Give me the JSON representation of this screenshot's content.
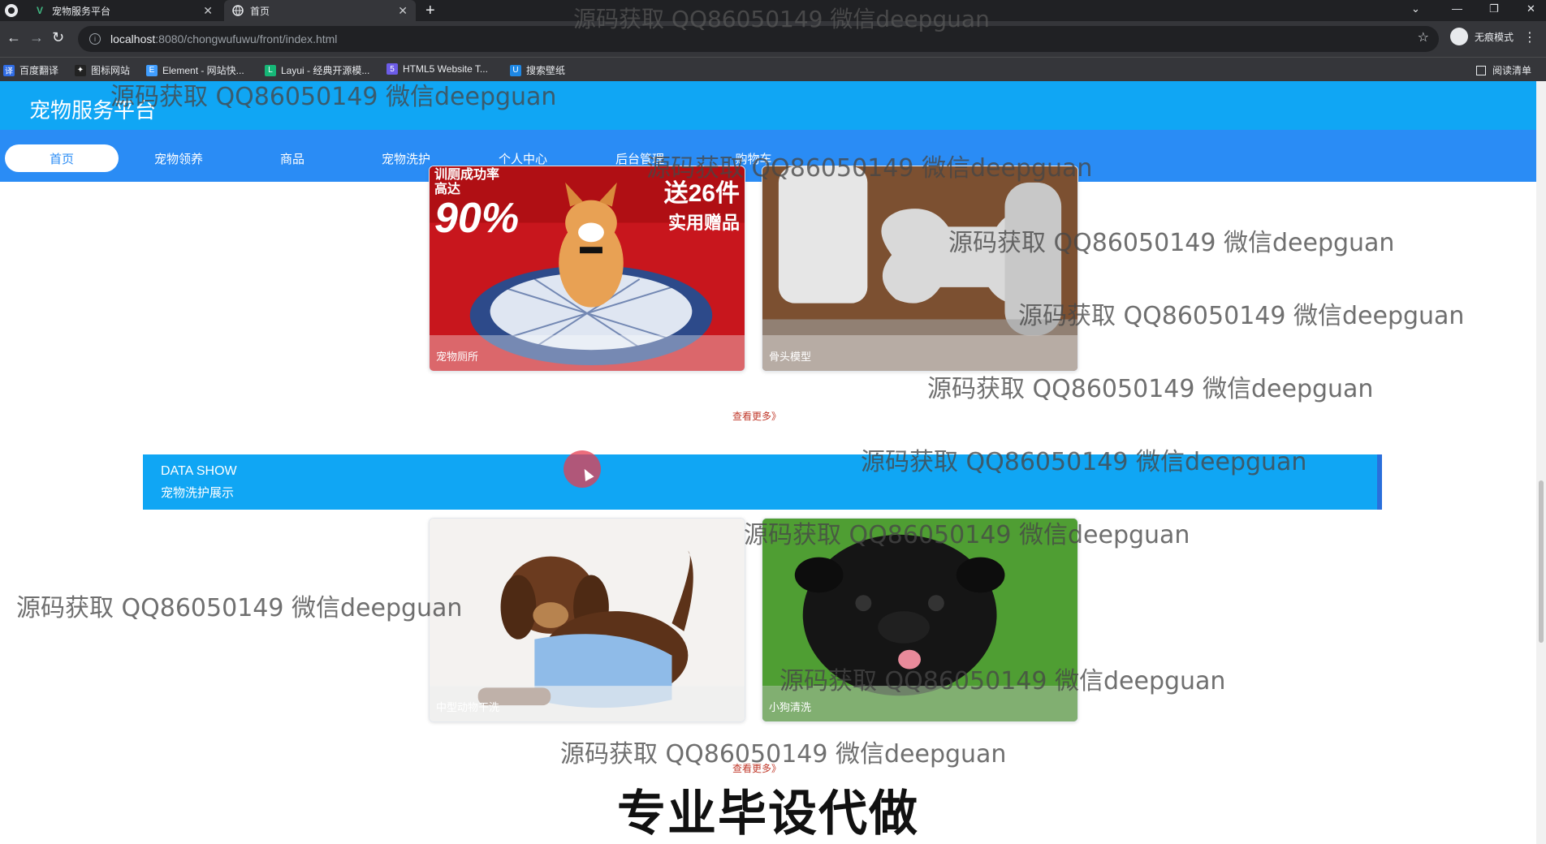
{
  "browser": {
    "tabs": [
      {
        "title": "宠物服务平台",
        "icon": "vue-icon"
      },
      {
        "title": "首页",
        "icon": "globe-icon"
      }
    ],
    "url_host": "localhost",
    "url_path": ":8080/chongwufuwu/front/index.html",
    "incognito_label": "无痕模式",
    "bookmarks": [
      {
        "label": "百度翻译",
        "icon": "translate-icon",
        "color": "#2f6ce5"
      },
      {
        "label": "图标网站",
        "icon": "bird-icon",
        "color": "#222222"
      },
      {
        "label": "Element - 网站快...",
        "icon": "element-icon",
        "color": "#409eff"
      },
      {
        "label": "Layui - 经典开源模...",
        "icon": "layui-icon",
        "color": "#16b777"
      },
      {
        "label": "HTML5 Website T...",
        "icon": "html5-icon",
        "color": "#6c5ce7"
      },
      {
        "label": "搜索壁纸",
        "icon": "wallpaper-icon",
        "color": "#1e88e5"
      }
    ],
    "reading_list": "阅读清单"
  },
  "site": {
    "title": "宠物服务平台",
    "nav": [
      "首页",
      "宠物领养",
      "商品",
      "宠物洗护",
      "个人中心",
      "后台管理",
      "购物车"
    ],
    "active_nav": "首页"
  },
  "products": [
    {
      "caption": "宠物厕所",
      "promo_top": "训厕成功率 高达",
      "promo_big": "90%",
      "promo_right_1": "送26件",
      "promo_right_2": "实用赠品"
    },
    {
      "caption": "骨头模型"
    }
  ],
  "more_label": "查看更多》",
  "banner": {
    "en": "DATA SHOW",
    "cn": "宠物洗护展示"
  },
  "services": [
    {
      "caption": "中型动物干洗"
    },
    {
      "caption": "小狗清洗"
    }
  ],
  "bottom_caption": "专业毕设代做",
  "watermark": "源码获取 QQ86050149 微信deepguan",
  "colors": {
    "header": "#10a6f4",
    "nav": "#2a8cf5",
    "more_link": "#c0392b"
  }
}
